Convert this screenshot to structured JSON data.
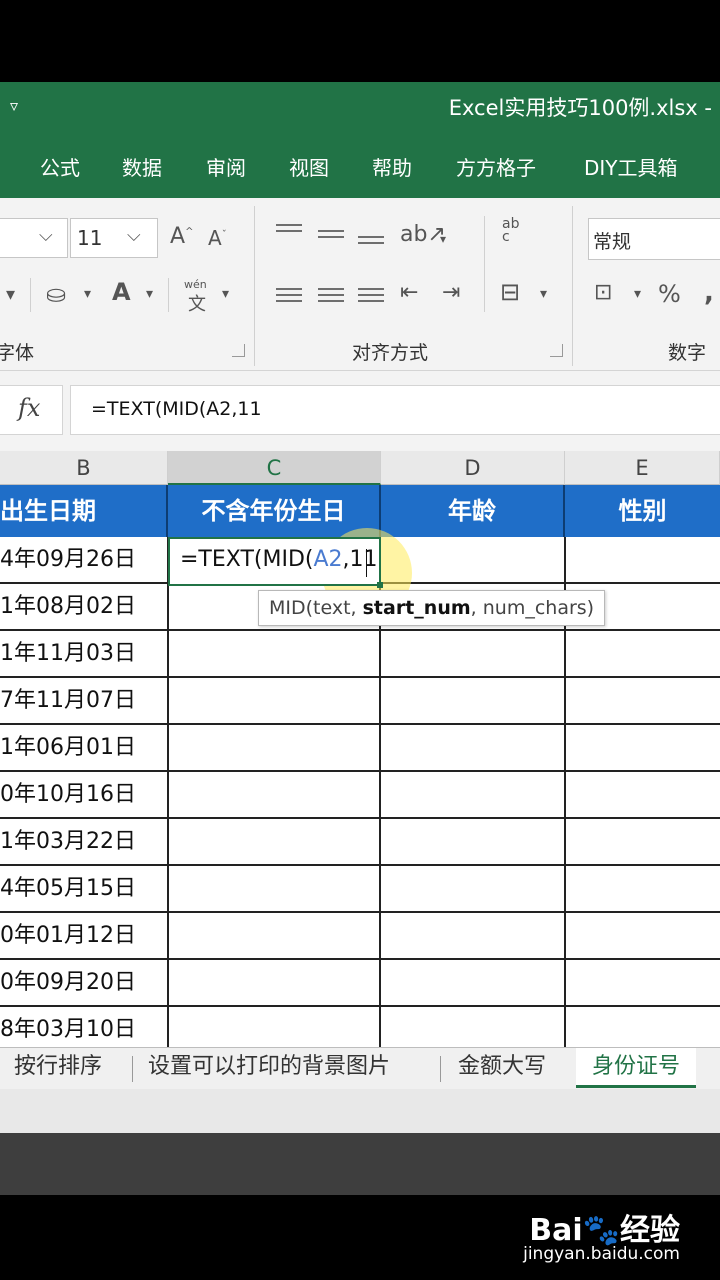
{
  "titlebar": {
    "qat_arrow": "▿",
    "document_title": "Excel实用技巧100例.xlsx  -"
  },
  "ribbon_tabs": [
    "公式",
    "数据",
    "审阅",
    "视图",
    "帮助",
    "方方格子",
    "DIY工具箱"
  ],
  "ribbon": {
    "font_size": "11",
    "wrap_icon_text": "ab c",
    "phonetic_top": "wén",
    "phonetic_char": "文",
    "number_format": "常规",
    "percent": "%",
    "comma": ",",
    "groups": {
      "font": "字体",
      "alignment": "对齐方式",
      "number": "数字"
    }
  },
  "formula_bar": {
    "fx_label": "fx",
    "formula": "=TEXT(MID(A2,11"
  },
  "columns": [
    "B",
    "C",
    "D",
    "E"
  ],
  "header_row": [
    "出生日期",
    "不含年份生日",
    "年龄",
    "性别"
  ],
  "birth_dates": [
    "4年09月26日",
    "1年08月02日",
    "1年11月03日",
    "7年11月07日",
    "1年06月01日",
    "0年10月16日",
    "1年03月22日",
    "4年05月15日",
    "0年01月12日",
    "0年09月20日",
    "8年03月10日"
  ],
  "active_cell": {
    "formula_prefix": "=TEXT(MID(",
    "formula_ref": "A2",
    "formula_suffix": ",11"
  },
  "tooltip": {
    "func": "MID(text, ",
    "current_arg": "start_num",
    "rest": ", num_chars)"
  },
  "sheet_tabs": [
    {
      "label": "按行排序",
      "active": false
    },
    {
      "label": "设置可以打印的背景图片",
      "active": false
    },
    {
      "label": "金额大写",
      "active": false
    },
    {
      "label": "身份证号",
      "active": true
    }
  ],
  "watermark": {
    "logo": "Bai🐾经验",
    "url": "jingyan.baidu.com"
  },
  "colors": {
    "excel_green": "#217346",
    "header_blue": "#1f6ec8",
    "ref_blue": "#4a7bd0"
  }
}
